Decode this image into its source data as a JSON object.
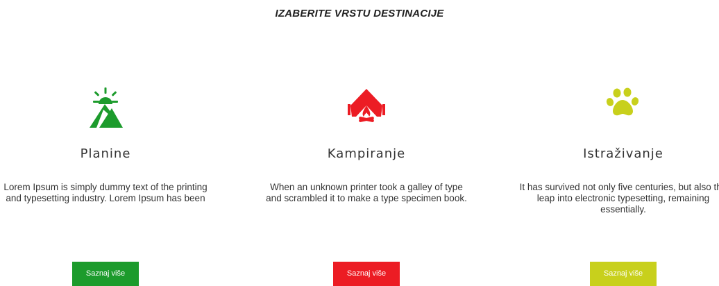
{
  "section": {
    "title": "IZABERITE VRSTU DESTINACIJE"
  },
  "cards": [
    {
      "name": "Planine",
      "icon": "mountain-sun-icon",
      "description": "Lorem Ipsum is simply dummy text of the printing and typesetting industry. Lorem Ipsum has been",
      "button_label": "Saznaj više",
      "color": "#1c9b2c"
    },
    {
      "name": "Kampiranje",
      "icon": "tent-campfire-icon",
      "description": "When an unknown printer took a galley of type and scrambled it to make a type specimen book.",
      "button_label": "Saznaj više",
      "color": "#ec1c24"
    },
    {
      "name": "Istraživanje",
      "icon": "paw-print-icon",
      "description": "It has survived not only five centuries, but also the leap into electronic typesetting, remaining essentially.",
      "button_label": "Saznaj više",
      "color": "#c8d01c"
    }
  ]
}
